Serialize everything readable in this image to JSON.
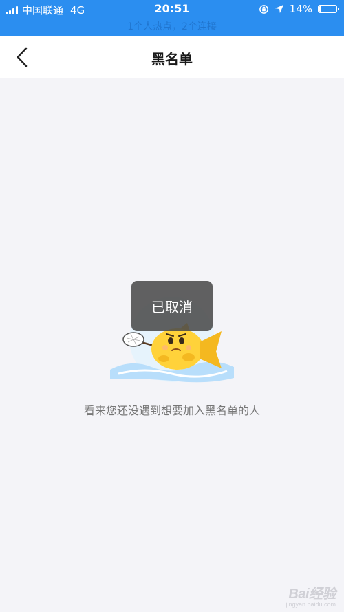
{
  "status_bar": {
    "carrier": "中国联通",
    "network": "4G",
    "time": "20:51",
    "battery": "14%",
    "battery_level": 0.14,
    "hotspot_text": "1个人热点，2个连接",
    "colors": {
      "background": "#2b8ef0"
    }
  },
  "nav": {
    "title": "黑名单",
    "back_icon": "chevron-left-icon"
  },
  "empty_state": {
    "message": "看来您还没遇到想要加入黑名单的人",
    "illustration": "fish-with-net-illustration"
  },
  "toast": {
    "text": "已取消"
  },
  "watermark": {
    "text": "Bai经验",
    "sub": "jingyan.baidu.com"
  }
}
